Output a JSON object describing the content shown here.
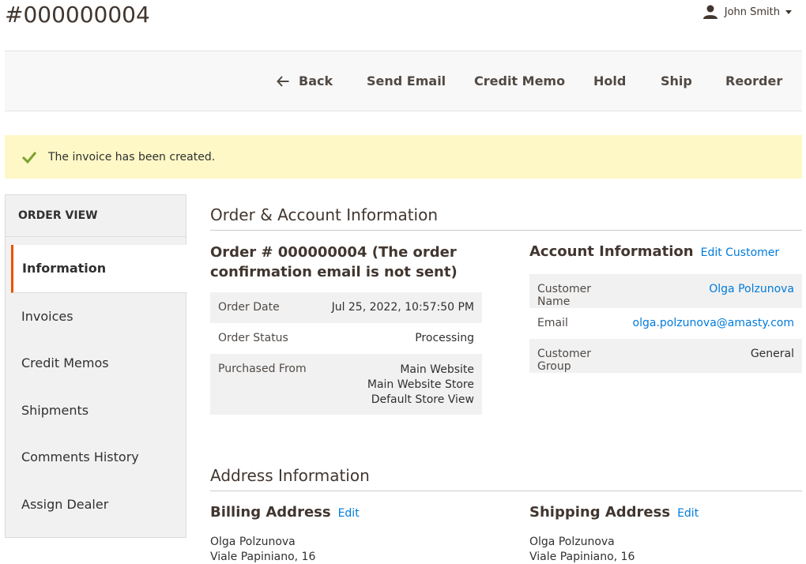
{
  "page": {
    "title": "#000000004"
  },
  "user": {
    "name": "John Smith"
  },
  "actions": {
    "back": "Back",
    "send_email": "Send Email",
    "credit_memo": "Credit Memo",
    "hold": "Hold",
    "ship": "Ship",
    "reorder": "Reorder"
  },
  "message": {
    "text": "The invoice has been created.",
    "color": "#fdf8c6",
    "icon": "check-icon"
  },
  "sidebar": {
    "heading": "ORDER VIEW",
    "items": [
      {
        "label": "Information",
        "active": true
      },
      {
        "label": "Invoices"
      },
      {
        "label": "Credit Memos"
      },
      {
        "label": "Shipments"
      },
      {
        "label": "Comments History"
      },
      {
        "label": "Assign Dealer"
      }
    ]
  },
  "order_account": {
    "section_title": "Order & Account Information",
    "order_title": "Order # 000000004 (The order confirmation email is not sent)",
    "order_rows": [
      {
        "label": "Order Date",
        "value": "Jul 25, 2022, 10:57:50 PM"
      },
      {
        "label": "Order Status",
        "value": "Processing"
      },
      {
        "label": "Purchased From",
        "value_lines": [
          "Main Website",
          "Main Website Store",
          "Default Store View"
        ]
      }
    ],
    "account_title": "Account Information",
    "edit_customer": "Edit Customer",
    "account_rows": [
      {
        "label": "Customer Name",
        "value": "Olga Polzunova",
        "is_link": true
      },
      {
        "label": "Email",
        "value": "olga.polzunova@amasty.com",
        "is_link": true
      },
      {
        "label": "Customer Group",
        "value": "General"
      }
    ]
  },
  "address_info": {
    "section_title": "Address Information",
    "billing": {
      "title": "Billing Address",
      "edit": "Edit",
      "lines": [
        "Olga Polzunova",
        "Viale Papiniano, 16"
      ]
    },
    "shipping": {
      "title": "Shipping Address",
      "edit": "Edit",
      "lines": [
        "Olga Polzunova",
        "Viale Papiniano, 16"
      ]
    }
  },
  "colors": {
    "accent": "#eb5202",
    "link": "#007bdb",
    "text": "#303030"
  }
}
